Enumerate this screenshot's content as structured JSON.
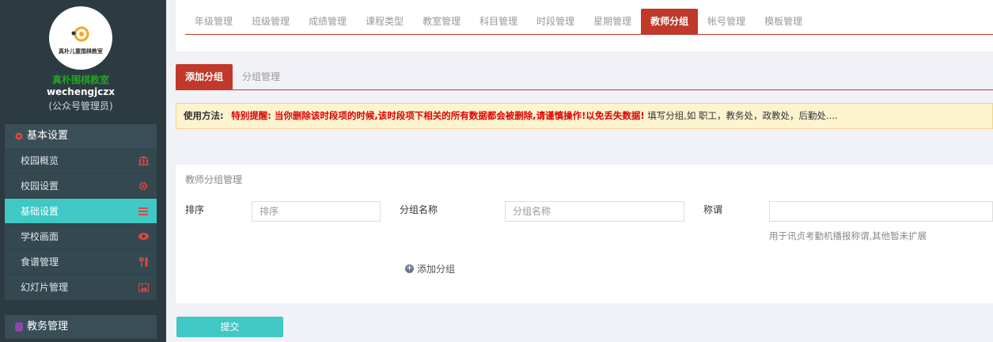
{
  "sidebar": {
    "logo_caption": "真朴儿童围棋教室",
    "school_name": "真朴围棋教室",
    "username": "wechengjczx",
    "role": "(公众号管理员)",
    "groups": [
      {
        "title": "基本设置",
        "icon": "gear-icon",
        "items": [
          {
            "label": "校园概览",
            "icon": "bank-icon"
          },
          {
            "label": "校园设置",
            "icon": "cog-icon"
          },
          {
            "label": "基础设置",
            "icon": "list-icon",
            "active": true
          },
          {
            "label": "学校画面",
            "icon": "eye-icon"
          },
          {
            "label": "食谱管理",
            "icon": "utensils-icon"
          },
          {
            "label": "幻灯片管理",
            "icon": "image-icon"
          }
        ]
      },
      {
        "title": "教务管理",
        "icon": "database-icon",
        "items": []
      }
    ]
  },
  "top_tabs": [
    {
      "label": "年级管理"
    },
    {
      "label": "班级管理"
    },
    {
      "label": "成绩管理"
    },
    {
      "label": "课程类型"
    },
    {
      "label": "教室管理"
    },
    {
      "label": "科目管理"
    },
    {
      "label": "时段管理"
    },
    {
      "label": "星期管理"
    },
    {
      "label": "教师分组",
      "active": true
    },
    {
      "label": "帐号管理"
    },
    {
      "label": "模板管理"
    }
  ],
  "sub_tabs": [
    {
      "label": "添加分组",
      "active": true
    },
    {
      "label": "分组管理"
    }
  ],
  "notice": {
    "label": "使用方法:",
    "warning": "特别提醒: 当你删除该时段项的时候,该时段项下相关的所有数据都会被删除,请谨慎操作!以免丢失数据!",
    "tip": "填写分组,如 职工，教务处，政教处，后勤处...."
  },
  "form": {
    "title": "教师分组管理",
    "order_label": "排序",
    "order_placeholder": "排序",
    "name_label": "分组名称",
    "name_placeholder": "分组名称",
    "title_label": "称谓",
    "title_placeholder": "",
    "hint": "用于讯贞考勤机播报称谓,其他暂未扩展",
    "add_label": "添加分组"
  },
  "submit_label": "提交",
  "colors": {
    "accent_red": "#c0392b",
    "accent_teal": "#3fc8c4",
    "sidebar_bg": "#2c3b41",
    "school_green": "#1fa31f"
  }
}
